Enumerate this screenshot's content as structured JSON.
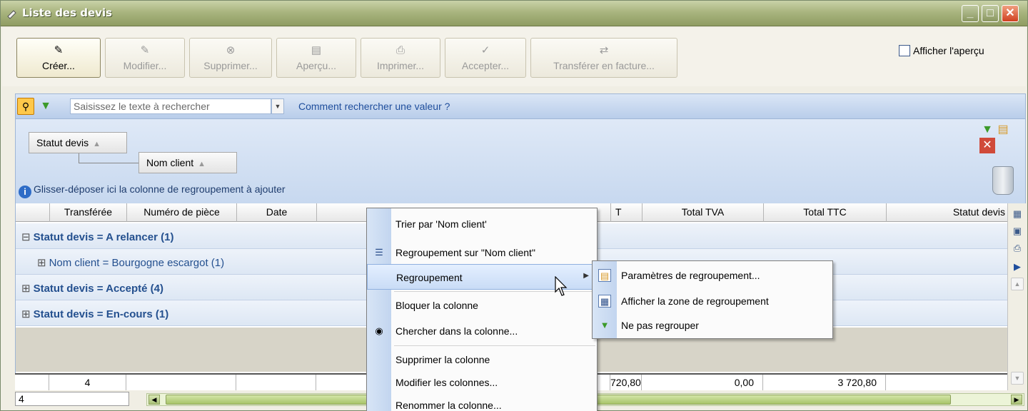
{
  "window": {
    "title": "Liste des devis",
    "min_glyph": "_",
    "max_glyph": "□",
    "close_glyph": "✕"
  },
  "toolbar": {
    "buttons": [
      {
        "label": "Créer...",
        "icon": "✎",
        "active": true
      },
      {
        "label": "Modifier...",
        "icon": "✎",
        "active": false
      },
      {
        "label": "Supprimer...",
        "icon": "⊗",
        "active": false
      },
      {
        "label": "Aperçu...",
        "icon": "▤",
        "active": false
      },
      {
        "label": "Imprimer...",
        "icon": "⎙",
        "active": false
      },
      {
        "label": "Accepter...",
        "icon": "✓",
        "active": false
      },
      {
        "label": "Transférer en facture...",
        "icon": "⇄",
        "active": false
      }
    ],
    "preview_checkbox": "Afficher l'aperçu"
  },
  "search": {
    "placeholder": "Saisissez le texte à rechercher",
    "help_link": "Comment rechercher une valeur ?"
  },
  "grouping": {
    "chip1": "Statut devis",
    "chip2": "Nom client",
    "hint": "Glisser-déposer ici la colonne de regroupement à ajouter"
  },
  "grid": {
    "columns": [
      "Transférée",
      "Numéro de pièce",
      "Date",
      "",
      "T",
      "Total TVA",
      "Total TTC",
      "Statut devis"
    ],
    "group_rows": [
      {
        "text": "Statut devis = A relancer (1)",
        "sign": "⊟"
      },
      {
        "text": "Nom client = Bourgogne escargot (1)",
        "sign": "⊞"
      },
      {
        "text": "Statut devis = Accepté (4)",
        "sign": "⊞"
      },
      {
        "text": "Statut devis = En-cours (1)",
        "sign": "⊞"
      }
    ],
    "footer": {
      "count": "4",
      "total_ht": "720,80",
      "total_tva": "0,00",
      "total_ttc": "3 720,80"
    },
    "record_count": "4"
  },
  "context_menu": {
    "items": [
      "Trier par 'Nom client'",
      "Regroupement sur \"Nom client\"",
      "Regroupement",
      "Bloquer la colonne",
      "Chercher dans la colonne...",
      "Supprimer la colonne",
      "Modifier les colonnes...",
      "Renommer la colonne..."
    ]
  },
  "submenu": {
    "items": [
      "Paramètres de regroupement...",
      "Afficher la zone de regroupement",
      "Ne pas regrouper"
    ]
  }
}
